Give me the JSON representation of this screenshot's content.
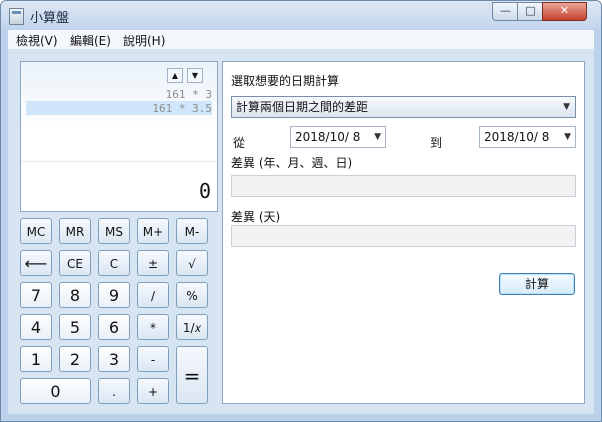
{
  "window": {
    "title": "小算盤"
  },
  "menu": [
    "檢視(V)",
    "編輯(E)",
    "說明(H)"
  ],
  "display": {
    "history": [
      "161 * 3",
      "161 * 3.5"
    ],
    "value": "0"
  },
  "keys": {
    "mc": "MC",
    "mr": "MR",
    "ms": "MS",
    "mplus": "M+",
    "mminus": "M-",
    "back": "⟵",
    "ce": "CE",
    "c": "C",
    "plusminus": "±",
    "sqrt": "√",
    "n7": "7",
    "n8": "8",
    "n9": "9",
    "div": "/",
    "pct": "%",
    "n4": "4",
    "n5": "5",
    "n6": "6",
    "mul": "*",
    "inv": "1/𝑥",
    "n1": "1",
    "n2": "2",
    "n3": "3",
    "minus": "-",
    "eq": "=",
    "n0": "0",
    "dot": ".",
    "plus": "+"
  },
  "date_calc": {
    "prompt": "選取想要的日期計算",
    "mode_selected": "計算兩個日期之間的差距",
    "from_label": "從",
    "from_value": "2018/10/  8",
    "to_label": "到",
    "to_value": "2018/10/  8",
    "diff_ymwd_label": "差異 (年、月、週、日)",
    "diff_days_label": "差異 (天)",
    "calculate_button": "計算"
  }
}
